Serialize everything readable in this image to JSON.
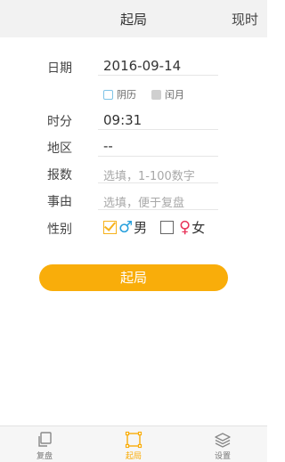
{
  "header": {
    "title": "起局",
    "right_action": "现时"
  },
  "form": {
    "date": {
      "label": "日期",
      "value": "2016-09-14"
    },
    "calendar_options": {
      "lunar": "阴历",
      "leap_month": "闰月"
    },
    "time": {
      "label": "时分",
      "value": "09:31"
    },
    "region": {
      "label": "地区",
      "value": "--"
    },
    "number": {
      "label": "报数",
      "placeholder": "选填，1-100数字"
    },
    "reason": {
      "label": "事由",
      "placeholder": "选填，便于复盘"
    },
    "gender": {
      "label": "性别",
      "male": "男",
      "female": "女",
      "male_symbol": "♂",
      "female_symbol": "♀",
      "selected": "male"
    }
  },
  "submit_label": "起局",
  "tabs": [
    {
      "label": "复盘",
      "icon": "copy-icon",
      "active": false
    },
    {
      "label": "起局",
      "icon": "frame-icon",
      "active": true
    },
    {
      "label": "设置",
      "icon": "layers-icon",
      "active": false
    }
  ],
  "colors": {
    "accent": "#f9ad0a",
    "male": "#28a0dc",
    "female": "#e8345a"
  }
}
